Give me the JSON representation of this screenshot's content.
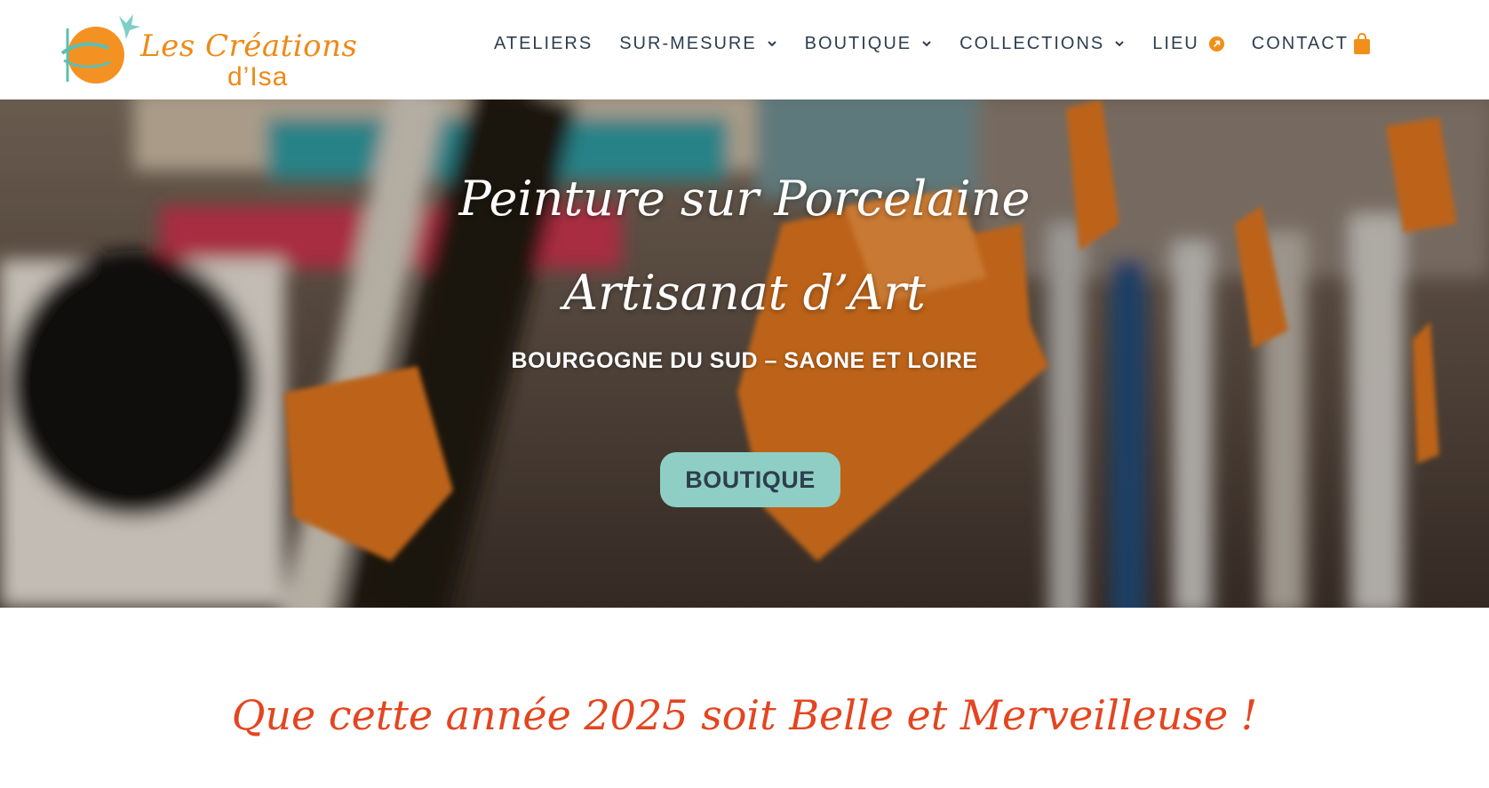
{
  "brand": {
    "line1": "Les Créations",
    "line2": "d’Isa",
    "colors": {
      "orange": "#ee8a17",
      "teal": "#5bbfb5"
    }
  },
  "nav": {
    "items": [
      {
        "label": "ATELIERS",
        "has_dropdown": false
      },
      {
        "label": "SUR-MESURE",
        "has_dropdown": true
      },
      {
        "label": "BOUTIQUE",
        "has_dropdown": true
      },
      {
        "label": "COLLECTIONS",
        "has_dropdown": true
      },
      {
        "label": "LIEU",
        "has_dropdown": false,
        "icon": "external-link-icon"
      },
      {
        "label": "CONTACT",
        "has_dropdown": true
      }
    ],
    "cart_icon": "shopping-bag-icon",
    "text_color": "#2d3e50",
    "accent_color": "#f0901b"
  },
  "hero": {
    "title_line1": "Peinture sur Porcelaine",
    "title_line2": "Artisanat d’Art",
    "subtitle": "BOURGOGNE DU SUD – SAONE ET LOIRE",
    "button_label": "BOUTIQUE",
    "button_color": "#8fcec4"
  },
  "greeting": {
    "text": "Que cette année 2025 soit Belle et Merveilleuse !",
    "color": "#e4451f"
  }
}
